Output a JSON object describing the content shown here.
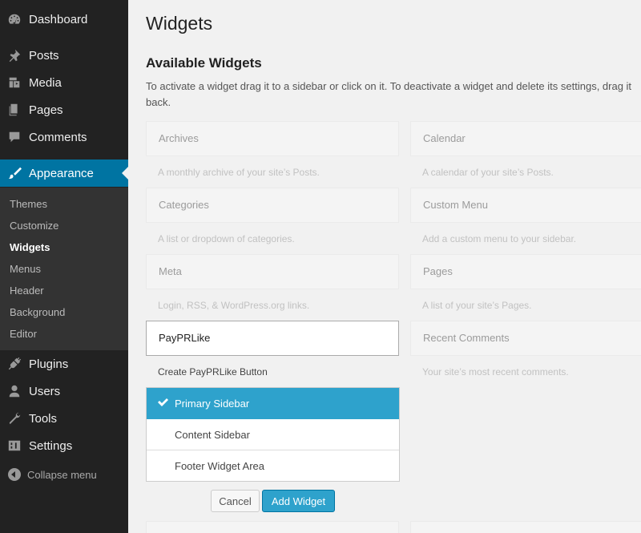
{
  "sidebar": {
    "items": [
      {
        "label": "Dashboard",
        "icon": "dashboard-icon"
      },
      {
        "label": "Posts",
        "icon": "pin-icon"
      },
      {
        "label": "Media",
        "icon": "media-icon"
      },
      {
        "label": "Pages",
        "icon": "pages-icon"
      },
      {
        "label": "Comments",
        "icon": "comment-icon"
      },
      {
        "label": "Appearance",
        "icon": "brush-icon"
      },
      {
        "label": "Plugins",
        "icon": "plugin-icon"
      },
      {
        "label": "Users",
        "icon": "user-icon"
      },
      {
        "label": "Tools",
        "icon": "wrench-icon"
      },
      {
        "label": "Settings",
        "icon": "settings-icon"
      }
    ],
    "submenu": [
      "Themes",
      "Customize",
      "Widgets",
      "Menus",
      "Header",
      "Background",
      "Editor"
    ],
    "collapse_label": "Collapse menu",
    "accent_color": "#0074a2"
  },
  "page": {
    "title": "Widgets",
    "section_title": "Available Widgets",
    "description_line1": "To activate a widget drag it to a sidebar or click on it. To deactivate a widget and delete its settings, drag it",
    "description_line2": "back."
  },
  "widgets": [
    {
      "title": "Archives",
      "desc": "A monthly archive of your site’s Posts."
    },
    {
      "title": "Calendar",
      "desc": "A calendar of your site’s Posts."
    },
    {
      "title": "Categories",
      "desc": "A list or dropdown of categories."
    },
    {
      "title": "Custom Menu",
      "desc": "Add a custom menu to your sidebar."
    },
    {
      "title": "Meta",
      "desc": "Login, RSS, & WordPress.org links."
    },
    {
      "title": "Pages",
      "desc": "A list of your site’s Pages."
    },
    {
      "title": "PayPRLike",
      "desc": "Create PayPRLike Button"
    },
    {
      "title": "Recent Comments",
      "desc": "Your site’s most recent comments."
    }
  ],
  "chooser": {
    "options": [
      "Primary Sidebar",
      "Content Sidebar",
      "Footer Widget Area"
    ],
    "selected": "Primary Sidebar",
    "cancel_label": "Cancel",
    "add_label": "Add Widget"
  }
}
